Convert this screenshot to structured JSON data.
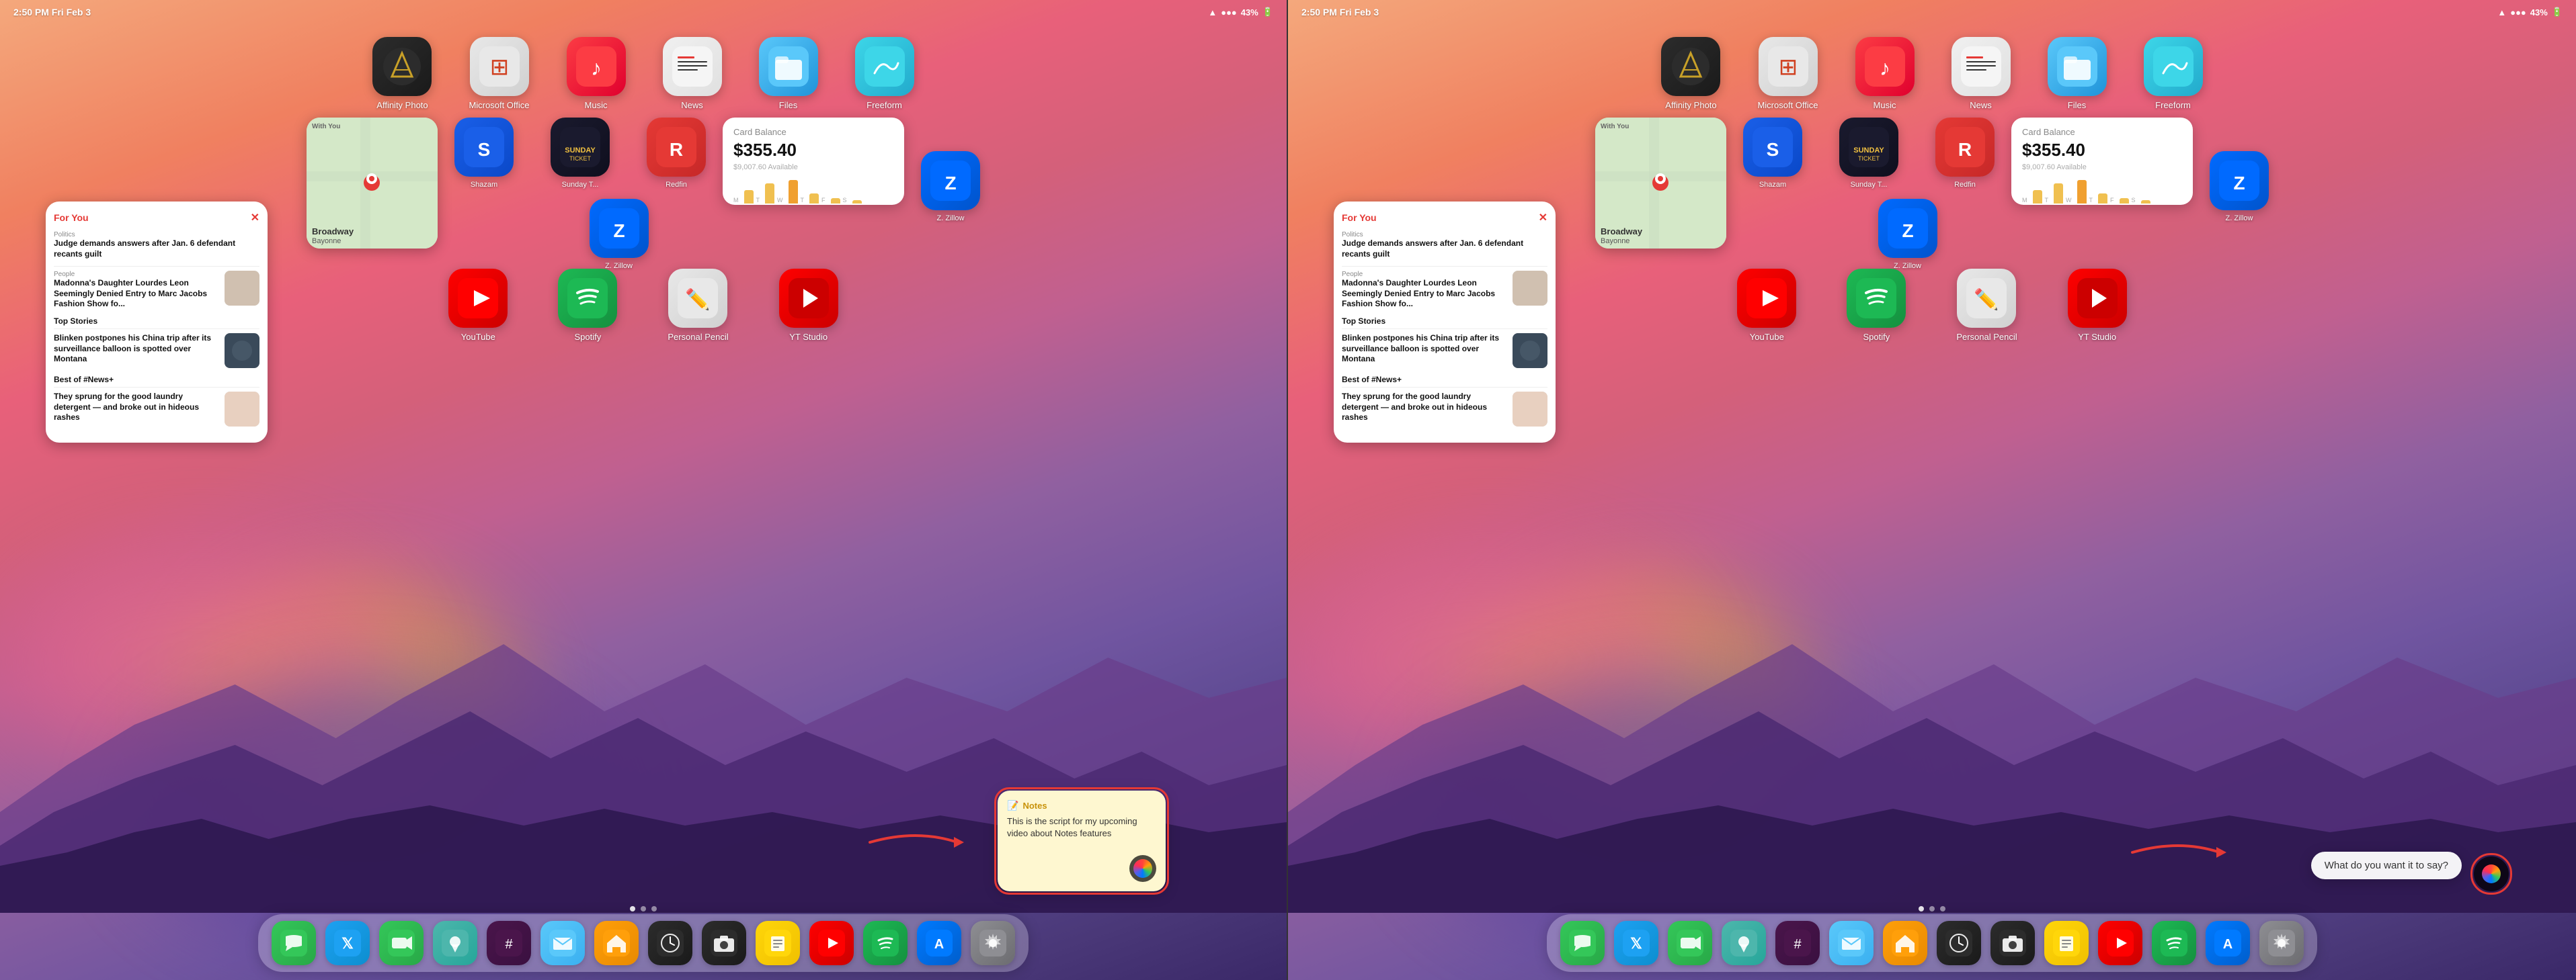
{
  "screens": [
    {
      "id": "left",
      "statusBar": {
        "left": "2:50 PM  Fri Feb 3",
        "right": "43%"
      },
      "apps_row1": [
        {
          "name": "Affinity Photo",
          "icon": "affinity",
          "label": "Affinity Photo"
        },
        {
          "name": "Microsoft Office",
          "icon": "office",
          "label": "Microsoft Office"
        },
        {
          "name": "Music",
          "icon": "music",
          "label": "Music"
        },
        {
          "name": "News",
          "icon": "news",
          "label": "News"
        },
        {
          "name": "Files",
          "icon": "files",
          "label": "Files"
        },
        {
          "name": "Freeform",
          "icon": "freeform",
          "label": "Freeform"
        }
      ],
      "widget_card": {
        "title": "Card Balance",
        "amount": "$355.40",
        "available": "$9,007.60 Available"
      },
      "maps_widget": {
        "with_you": "With You",
        "location": "Broadway",
        "sublocation": "Bayonne"
      },
      "apps_row2": [
        {
          "name": "Shazam",
          "icon": "shazam",
          "label": "Shazam"
        },
        {
          "name": "Sunday Ticket",
          "icon": "sunday",
          "label": "Sunday T..."
        },
        {
          "name": "Redfin",
          "icon": "redfin",
          "label": "Redfin"
        },
        {
          "name": "Zillow",
          "icon": "zillow",
          "label": "Z. Zillow"
        }
      ],
      "apps_row3": [
        {
          "name": "YouTube",
          "icon": "youtube",
          "label": "YouTube"
        },
        {
          "name": "Spotify",
          "icon": "spotify",
          "label": "Spotify"
        },
        {
          "name": "Personal Pencil",
          "icon": "personal",
          "label": "Personal Pencil"
        },
        {
          "name": "YT Studio",
          "icon": "yt-studio",
          "label": "YT Studio"
        }
      ],
      "news_widget": {
        "header": "For You",
        "items": [
          {
            "source": "Politics",
            "title": "Judge demands answers after Jan. 6 defendant recants guilt",
            "hasThumb": false
          },
          {
            "source": "People",
            "title": "Madonna's Daughter Lourdes Leon Seemingly Denied Entry to Marc Jacobs Fashion Show fo...",
            "hasThumb": true
          },
          {
            "section": "Top Stories"
          },
          {
            "source": "",
            "title": "Blinken postpones his China trip after its surveillance balloon is spotted over Montana",
            "hasThumb": true
          },
          {
            "section": "Best of #News+"
          },
          {
            "source": "",
            "title": "They sprung for the good laundry detergent — and broke out in hideous rashes",
            "hasThumb": true
          }
        ]
      },
      "notes_widget": {
        "title": "Notes",
        "content": "This is the script for my upcoming video about Notes features"
      },
      "siri_button": true,
      "red_box": true,
      "red_arrow": true,
      "dock": {
        "apps": [
          "Messages",
          "Twitter",
          "FaceTime",
          "Maps",
          "Slack",
          "Mail",
          "Home",
          "Clock",
          "Camera",
          "Notes",
          "YouTube",
          "Spotify",
          "App Store",
          "Settings"
        ]
      }
    },
    {
      "id": "right",
      "statusBar": {
        "left": "2:50 PM  Fri Feb 3",
        "right": "43%"
      },
      "siri_ask": "What do you want it to say?",
      "siri_active": true,
      "red_box_ask": true,
      "red_arrow_right": true
    }
  ]
}
